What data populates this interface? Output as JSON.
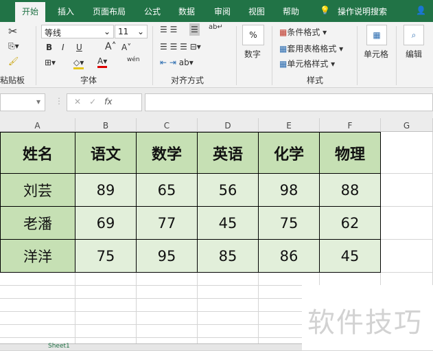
{
  "tabs": [
    "开始",
    "插入",
    "页面布局",
    "公式",
    "数据",
    "审阅",
    "视图",
    "帮助"
  ],
  "active_tab": "开始",
  "search": "操作说明搜索",
  "ribbon": {
    "font_name": "等线",
    "font_size": "11",
    "groups": [
      "粘贴板",
      "字体",
      "对齐方式",
      "数字",
      "样式",
      "单元格",
      "编辑"
    ],
    "styles": [
      "条件格式",
      "套用表格格式",
      "单元格样式"
    ],
    "number_label": "数字",
    "cells_label": "单元格",
    "edit_label": "编辑",
    "bold": "B",
    "italic": "I",
    "underline": "U",
    "pinyin": "wén"
  },
  "formula_bar": {
    "fx": "fx",
    "value": ""
  },
  "columns": [
    "A",
    "B",
    "C",
    "D",
    "E",
    "F",
    "G"
  ],
  "table": {
    "headers": [
      "姓名",
      "语文",
      "数学",
      "英语",
      "化学",
      "物理"
    ],
    "rows": [
      [
        "刘芸",
        "89",
        "65",
        "56",
        "98",
        "88"
      ],
      [
        "老潘",
        "69",
        "77",
        "45",
        "75",
        "62"
      ],
      [
        "洋洋",
        "75",
        "95",
        "85",
        "86",
        "45"
      ]
    ]
  },
  "sheet_tab": "Sheet1",
  "watermark": "软件技巧",
  "colors": {
    "brand": "#217346",
    "header_fill": "#c6e0b4",
    "data_fill": "#e2efda"
  }
}
